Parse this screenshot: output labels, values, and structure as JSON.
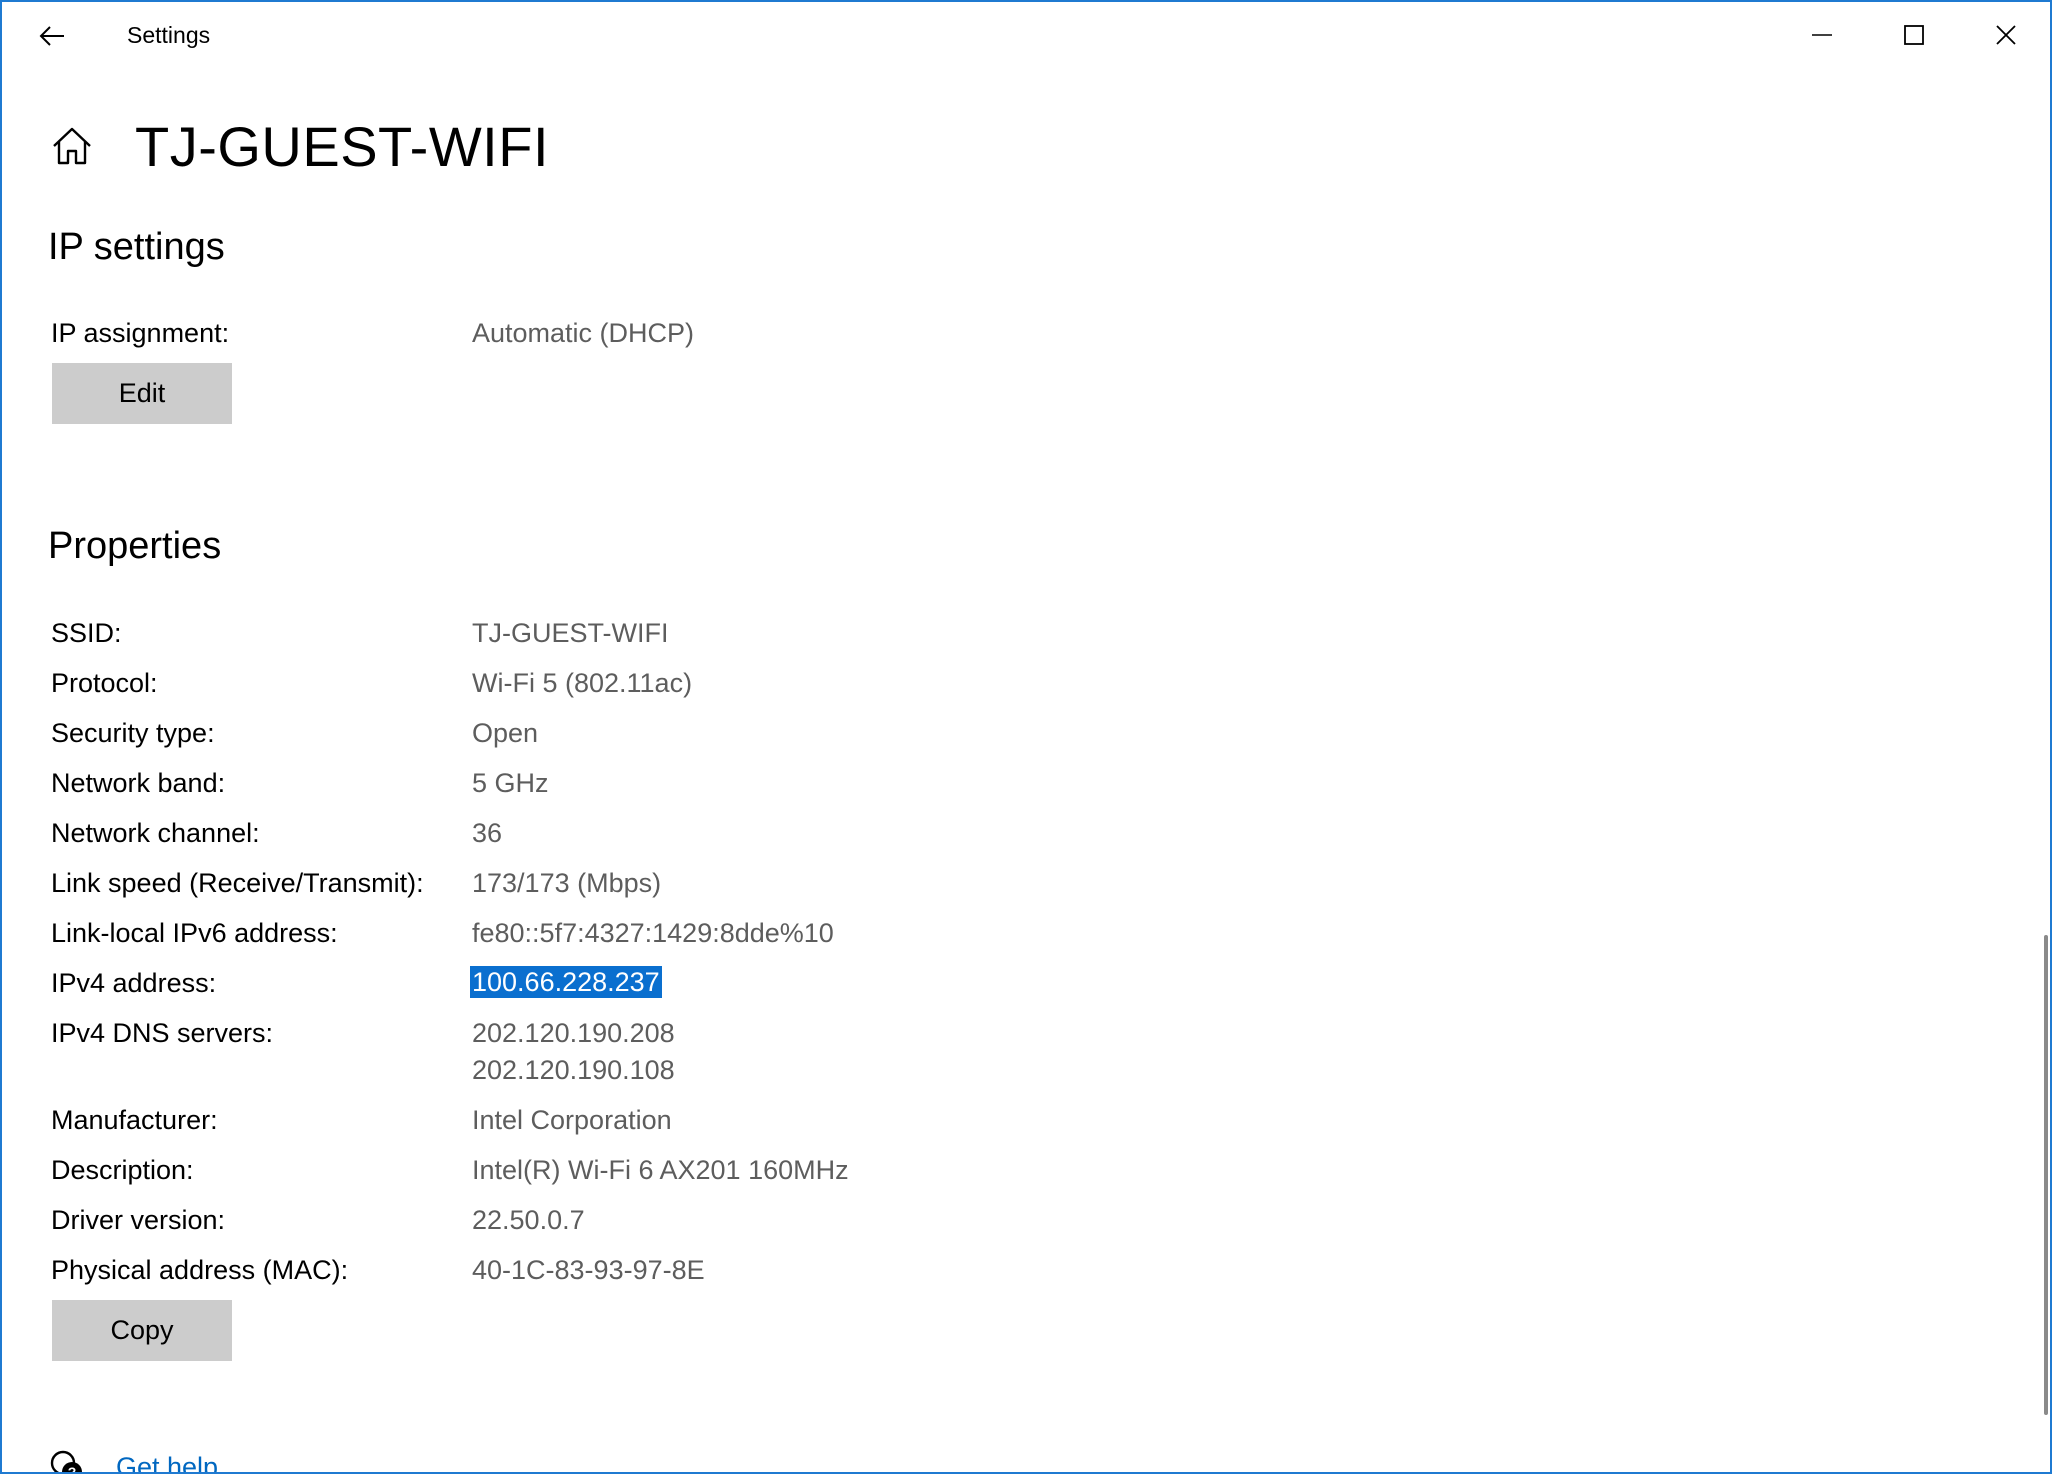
{
  "window": {
    "app_title": "Settings",
    "accent_color": "#1f7ad1",
    "selection_color": "#0a6fcf",
    "link_color": "#0067c0"
  },
  "title_bar": {
    "back_icon": "back-arrow-icon",
    "minimize_icon": "minimize-icon",
    "maximize_icon": "maximize-icon",
    "close_icon": "close-icon"
  },
  "header": {
    "home_icon": "home-icon",
    "title": "TJ-GUEST-WIFI"
  },
  "ip_settings": {
    "heading": "IP settings",
    "assignment_label": "IP assignment:",
    "assignment_value": "Automatic (DHCP)",
    "edit_label": "Edit"
  },
  "properties": {
    "heading": "Properties",
    "rows": [
      {
        "label": "SSID:",
        "value": "TJ-GUEST-WIFI"
      },
      {
        "label": "Protocol:",
        "value": "Wi-Fi 5 (802.11ac)"
      },
      {
        "label": "Security type:",
        "value": "Open"
      },
      {
        "label": "Network band:",
        "value": "5 GHz"
      },
      {
        "label": "Network channel:",
        "value": "36"
      },
      {
        "label": "Link speed (Receive/Transmit):",
        "value": "173/173 (Mbps)"
      },
      {
        "label": "Link-local IPv6 address:",
        "value": "fe80::5f7:4327:1429:8dde%10"
      },
      {
        "label": "IPv4 address:",
        "value": "100.66.228.237",
        "selected": true
      },
      {
        "label": "IPv4 DNS servers:",
        "value": "202.120.190.208",
        "value2": "202.120.190.108"
      },
      {
        "label": "Manufacturer:",
        "value": "Intel Corporation"
      },
      {
        "label": "Description:",
        "value": "Intel(R) Wi-Fi 6 AX201 160MHz"
      },
      {
        "label": "Driver version:",
        "value": "22.50.0.7"
      },
      {
        "label": "Physical address (MAC):",
        "value": "40-1C-83-93-97-8E"
      }
    ],
    "copy_label": "Copy"
  },
  "help": {
    "icon": "help-chat-icon",
    "link_label": "Get help"
  }
}
